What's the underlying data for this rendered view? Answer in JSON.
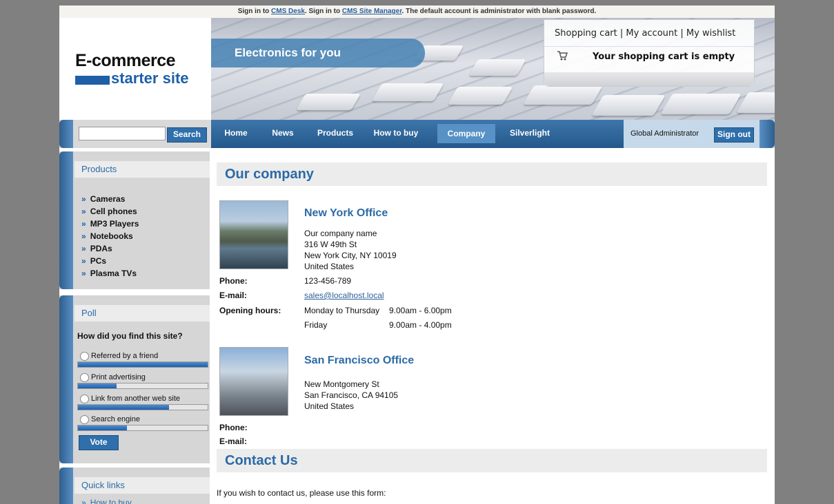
{
  "topbar": {
    "prefix": "Sign in to ",
    "cms_desk": "CMS Desk",
    "middle": ". Sign in to ",
    "site_manager": "CMS Site Manager",
    "suffix": ". The default account is administrator with blank password."
  },
  "logo": {
    "line1": "E-commerce",
    "line2": "starter site"
  },
  "banner": {
    "tagline": "Electronics for you"
  },
  "cart": {
    "shopping_cart": "Shopping cart",
    "my_account": "My account",
    "my_wishlist": "My wishlist",
    "separator": " | ",
    "empty_text": "Your shopping cart is empty",
    "icon": "cart-icon"
  },
  "search": {
    "value": "",
    "button": "Search"
  },
  "menu": [
    {
      "label": "Home",
      "active": false
    },
    {
      "label": "News",
      "active": false
    },
    {
      "label": "Products",
      "active": false
    },
    {
      "label": "How to buy",
      "active": false
    },
    {
      "label": "Company",
      "active": true
    },
    {
      "label": "Silverlight",
      "active": false
    }
  ],
  "user": {
    "name": "Global Administrator",
    "signout": "Sign out"
  },
  "products_box": {
    "title": "Products",
    "chevron": "»",
    "items": [
      "Cameras",
      "Cell phones",
      "MP3 Players",
      "Notebooks",
      "PDAs",
      "PCs",
      "Plasma TVs"
    ]
  },
  "poll": {
    "title": "Poll",
    "question": "How did you find this site?",
    "options": [
      {
        "label": "Referred by a friend",
        "fraction": 1.0
      },
      {
        "label": "Print advertising",
        "fraction": 0.3
      },
      {
        "label": "Link from another web site",
        "fraction": 0.7
      },
      {
        "label": "Search engine",
        "fraction": 0.38
      }
    ],
    "vote": "Vote"
  },
  "quick_links": {
    "title": "Quick links",
    "items": [
      "How to buy"
    ]
  },
  "content": {
    "heading": "Our company",
    "labels": {
      "phone": "Phone:",
      "email": "E-mail:",
      "hours": "Opening hours:"
    },
    "ny": {
      "title": "New York Office",
      "address": [
        "Our company name",
        "316 W 49th St",
        "New York City, NY 10019",
        "United States"
      ],
      "phone": "123-456-789",
      "email": "sales@localhost.local",
      "hours": [
        {
          "days": "Monday to Thursday",
          "time": "9.00am - 6.00pm"
        },
        {
          "days": "Friday",
          "time": "9.00am - 4.00pm"
        }
      ]
    },
    "sf": {
      "title": "San Francisco Office",
      "address": [
        "New Montgomery St",
        "San Francisco, CA 94105",
        "United States"
      ]
    },
    "contact_heading": "Contact Us",
    "contact_text": "If you wish to contact us, please use this form:"
  },
  "colors": {
    "accent": "#2b6aa6",
    "menu": "#23588a",
    "active_menu": "#5791c6"
  }
}
